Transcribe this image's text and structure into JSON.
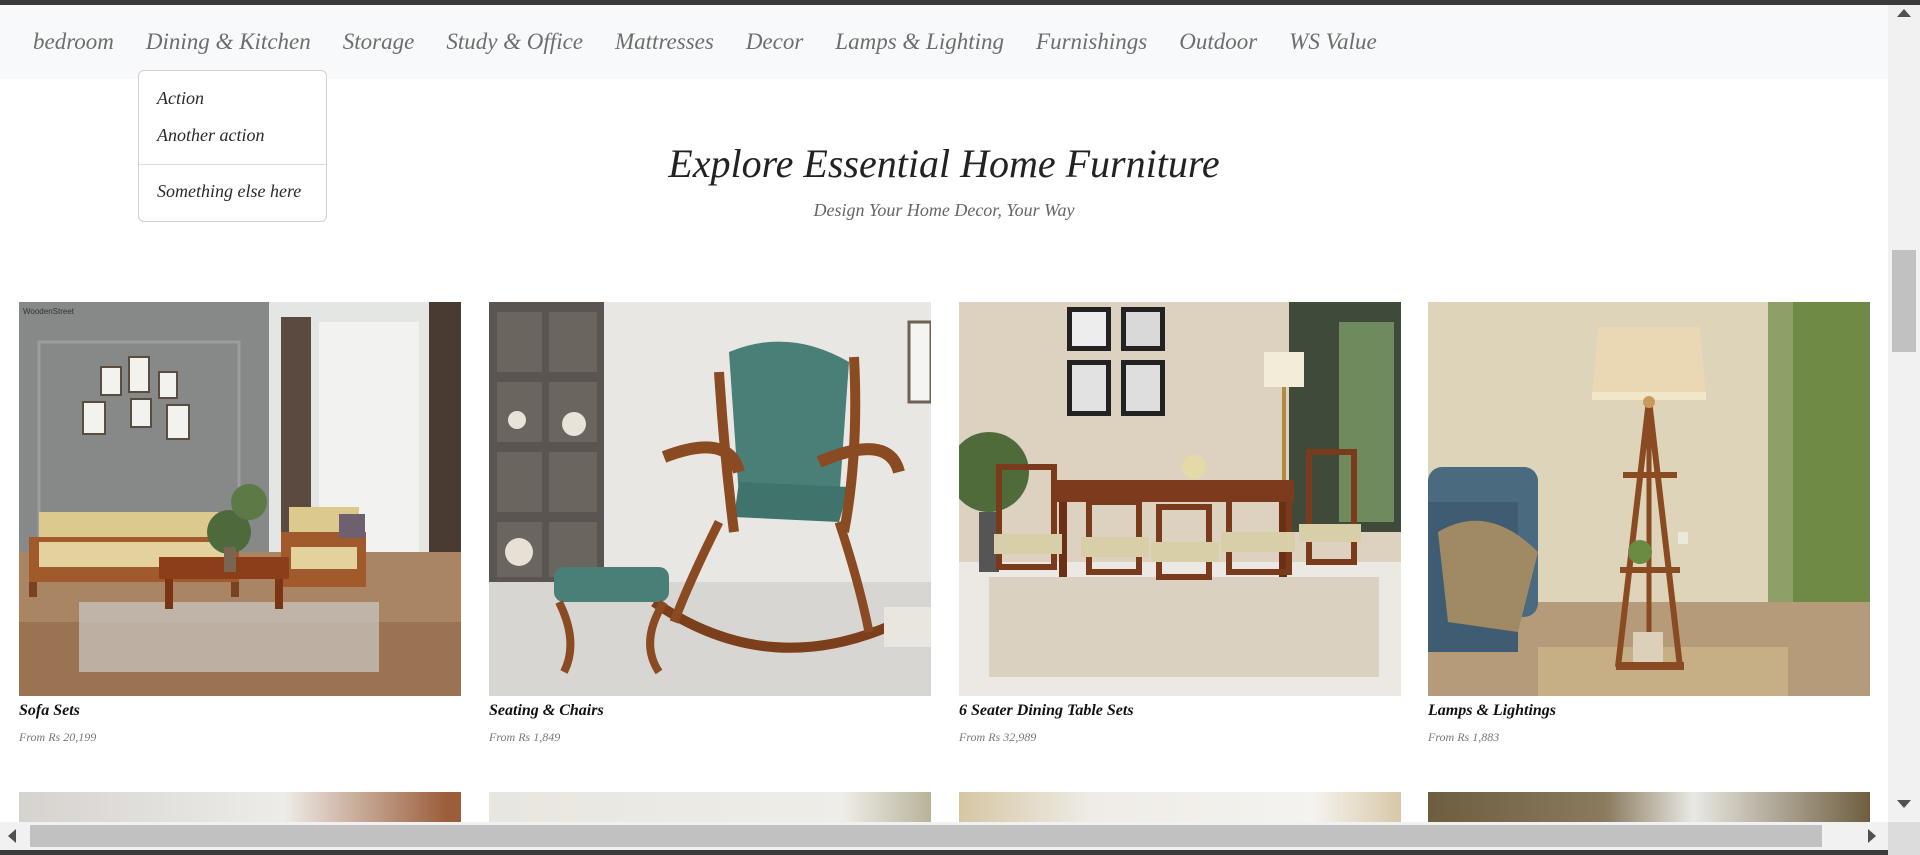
{
  "nav": {
    "items": [
      {
        "label": "bedroom"
      },
      {
        "label": "Dining & Kitchen"
      },
      {
        "label": "Storage"
      },
      {
        "label": "Study & Office"
      },
      {
        "label": "Mattresses"
      },
      {
        "label": "Decor"
      },
      {
        "label": "Lamps & Lighting"
      },
      {
        "label": "Furnishings"
      },
      {
        "label": "Outdoor"
      },
      {
        "label": "WS Value"
      }
    ]
  },
  "dropdown": {
    "items": [
      {
        "label": "Action"
      },
      {
        "label": "Another action"
      },
      {
        "label": "Something else here"
      }
    ]
  },
  "section": {
    "title": "Explore Essential Home Furniture",
    "subtitle": "Design Your Home Decor, Your Way"
  },
  "products": [
    {
      "name": "Sofa Sets",
      "price": "From Rs 20,199",
      "watermark": "WoodenStreet"
    },
    {
      "name": "Seating & Chairs",
      "price": "From Rs 1,849"
    },
    {
      "name": "6 Seater Dining Table Sets",
      "price": "From Rs 32,989"
    },
    {
      "name": "Lamps & Lightings",
      "price": "From Rs 1,883"
    }
  ]
}
